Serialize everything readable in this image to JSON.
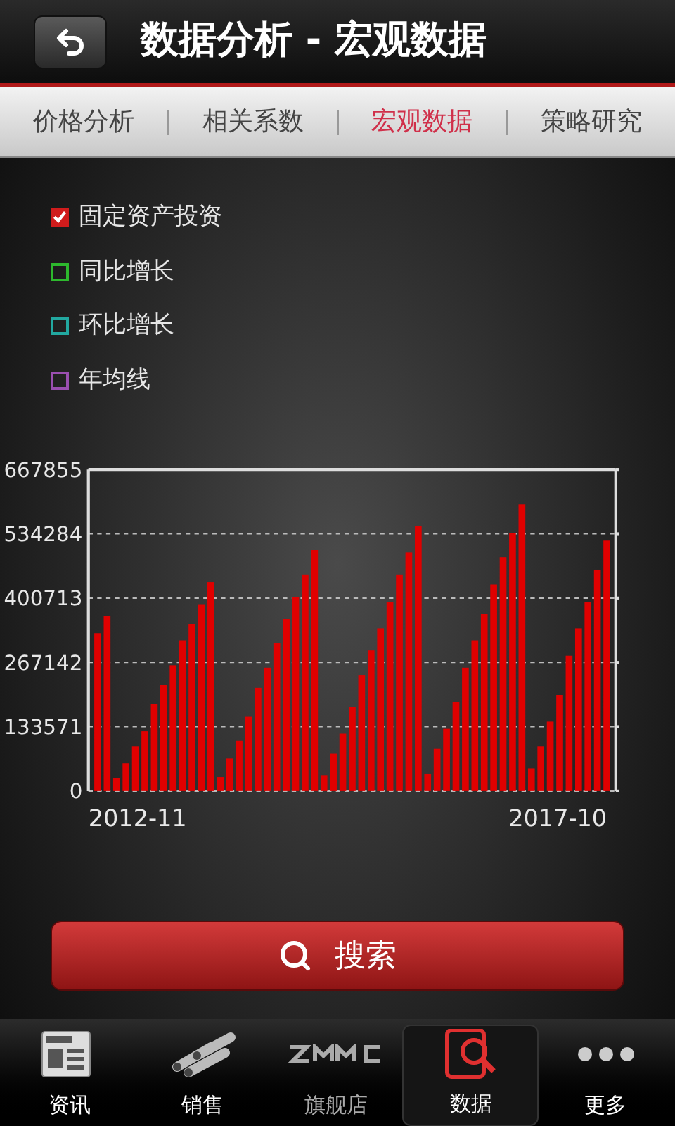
{
  "header": {
    "title": "数据分析 - 宏观数据"
  },
  "tabs": [
    {
      "label": "价格分析",
      "selected": false
    },
    {
      "label": "相关系数",
      "selected": false
    },
    {
      "label": "宏观数据",
      "selected": true
    },
    {
      "label": "策略研究",
      "selected": false
    }
  ],
  "legend": [
    {
      "label": "固定资产投资",
      "checked": true,
      "color": "#d01c1c"
    },
    {
      "label": "同比增长",
      "checked": false,
      "color": "#2db82d"
    },
    {
      "label": "环比增长",
      "checked": false,
      "color": "#22a8a0"
    },
    {
      "label": "年均线",
      "checked": false,
      "color": "#9a4fb0"
    }
  ],
  "chart": {
    "x_labels": [
      "2012-11",
      "2017-10"
    ],
    "chart_data": {
      "type": "bar",
      "grid": true,
      "series": [
        {
          "color": "#e00000",
          "values": [
            327000,
            363000,
            27000,
            58000,
            93000,
            124000,
            180000,
            220000,
            261000,
            312000,
            347000,
            388000,
            434000,
            29000,
            68000,
            104000,
            154000,
            215000,
            256000,
            307000,
            358000,
            403000,
            449000,
            500000,
            33000,
            78000,
            119000,
            175000,
            241000,
            292000,
            337000,
            393000,
            449000,
            495000,
            551000,
            35000,
            88000,
            129000,
            185000,
            256000,
            312000,
            368000,
            429000,
            485000,
            535000,
            596000,
            46000,
            93000,
            144000,
            200000,
            281000,
            337000,
            393000,
            459000,
            520000
          ]
        }
      ],
      "ylim": [
        0,
        667855
      ],
      "yticks": [
        0,
        133571,
        267142,
        400713,
        534284,
        667855
      ]
    }
  },
  "search_button": {
    "label": "搜索"
  },
  "nav": [
    {
      "label": "资讯",
      "selected": false
    },
    {
      "label": "销售",
      "selected": false
    },
    {
      "label": "旗舰店",
      "selected": false
    },
    {
      "label": "数据",
      "selected": true
    },
    {
      "label": "更多",
      "selected": false
    }
  ]
}
